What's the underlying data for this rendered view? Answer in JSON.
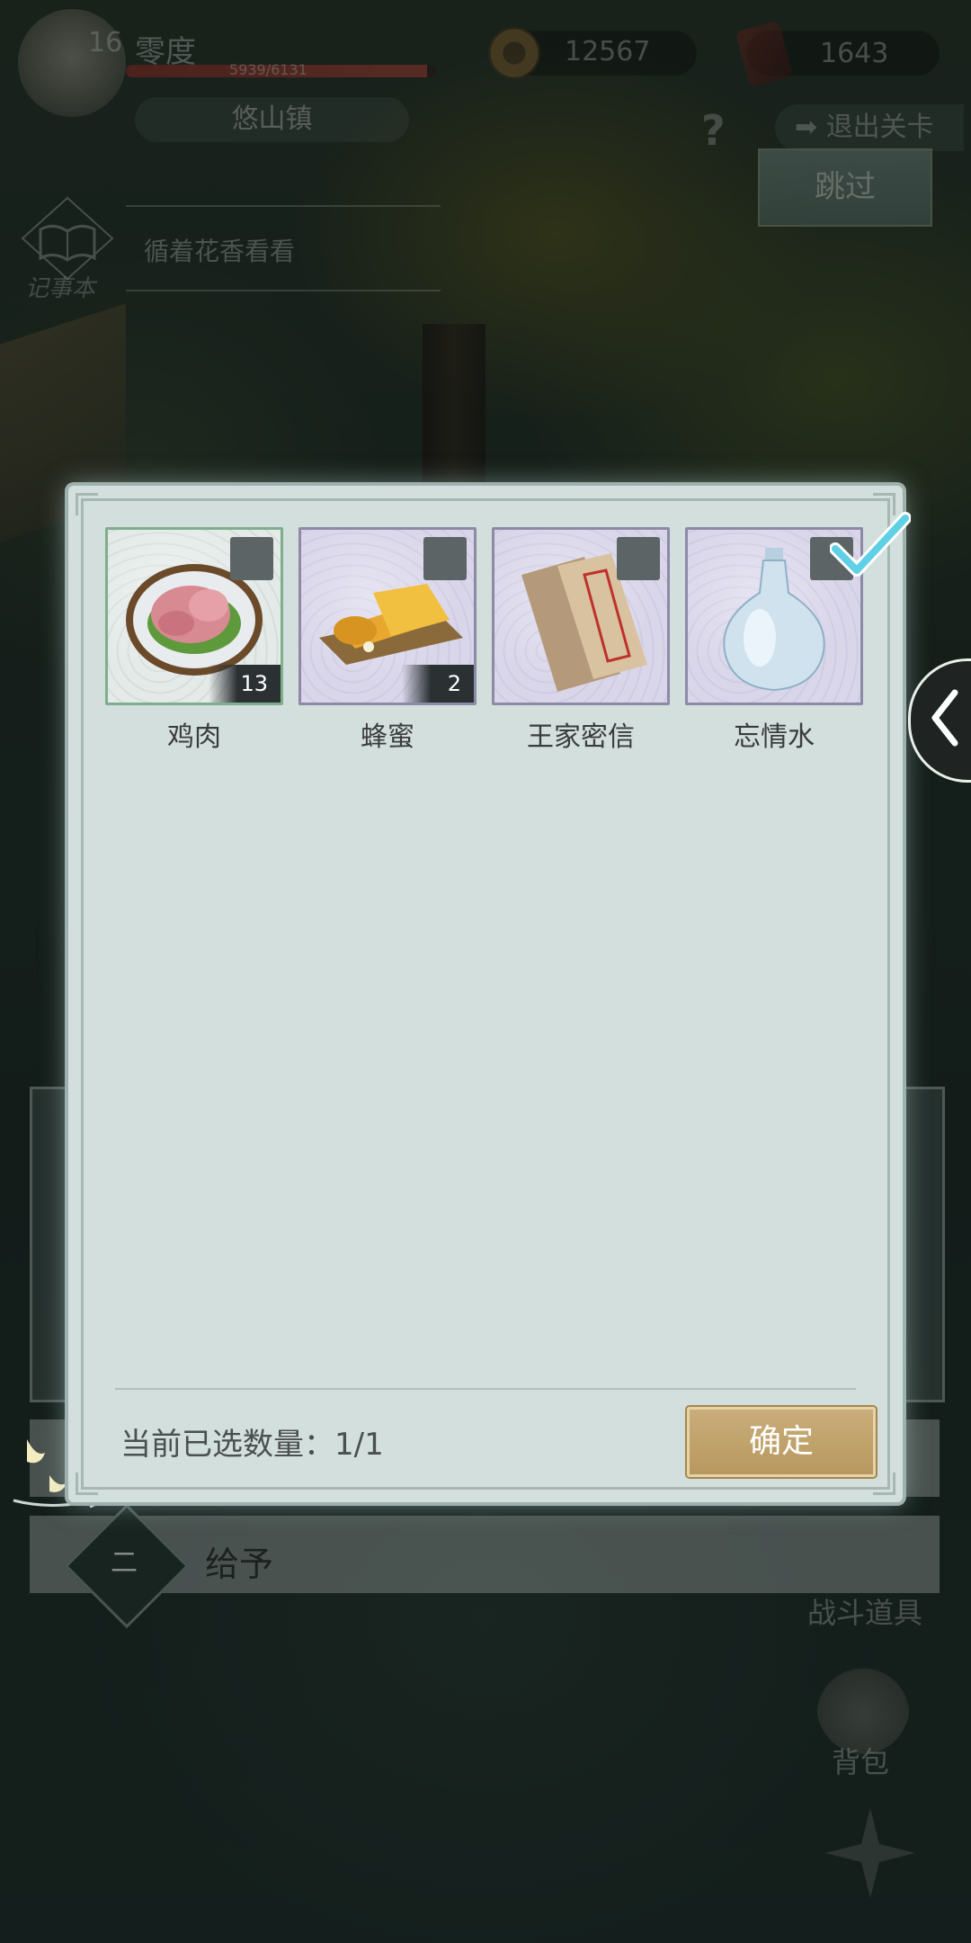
{
  "hud": {
    "level": "16",
    "player_name": "零度",
    "hp_text": "5939/6131",
    "hp_ratio": 0.97,
    "location": "悠山镇",
    "coins": "12567",
    "tickets": "1643",
    "exit_level_label": "退出关卡",
    "skip_label": "跳过",
    "quest_book_label": "记事本",
    "current_quest": "循着花香看看"
  },
  "modal": {
    "items": [
      {
        "name": "鸡肉",
        "quantity": "13",
        "selected": false,
        "icon": "chicken-meat-icon"
      },
      {
        "name": "蜂蜜",
        "quantity": "2",
        "selected": false,
        "icon": "honey-comb-icon"
      },
      {
        "name": "王家密信",
        "quantity": "",
        "selected": false,
        "icon": "secret-letter-icon"
      },
      {
        "name": "忘情水",
        "quantity": "",
        "selected": true,
        "icon": "porcelain-bottle-icon"
      }
    ],
    "selected_count_text": "当前已选数量：1/1",
    "confirm_label": "确定"
  },
  "dialogue": {
    "option_number": "二",
    "option_label": "给予"
  },
  "side_menu": {
    "battle_items_label": "战斗道具",
    "bag_label": "背包"
  },
  "colors": {
    "modal_bg": "#d2dfdd",
    "confirm_gold": "#c9ad7a",
    "check_cyan": "#5fd0e6"
  }
}
